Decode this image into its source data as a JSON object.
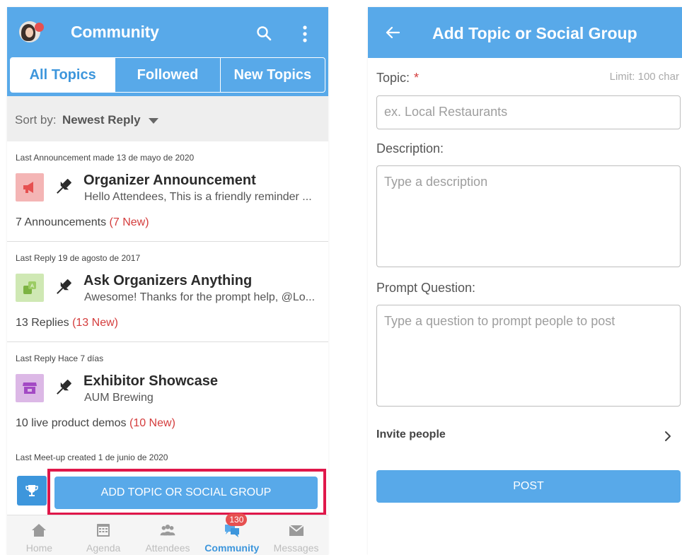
{
  "community": {
    "header": {
      "title": "Community"
    },
    "tabs": [
      {
        "label": "All Topics",
        "active": true
      },
      {
        "label": "Followed",
        "active": false
      },
      {
        "label": "New Topics",
        "active": false
      }
    ],
    "sort": {
      "label": "Sort by:",
      "value": "Newest Reply"
    },
    "topics": [
      {
        "meta": "Last Announcement made 13 de mayo de 2020",
        "icon": "megaphone-icon",
        "title": "Organizer Announcement",
        "subtitle": "Hello Attendees, This is a friendly reminder ...",
        "count": "7 Announcements",
        "new": "(7 New)"
      },
      {
        "meta": "Last Reply 19 de agosto de 2017",
        "icon": "translate-icon",
        "title": "Ask Organizers Anything",
        "subtitle": "Awesome! Thanks for the prompt help, @Lo...",
        "count": "13 Replies",
        "new": "(13 New)"
      },
      {
        "meta": "Last Reply Hace 7 días",
        "icon": "storefront-icon",
        "title": "Exhibitor Showcase",
        "subtitle": "AUM Brewing",
        "count": "10 live product demos",
        "new": "(10 New)"
      },
      {
        "meta": "Last Meet-up created 1 de junio de 2020",
        "icon": "trophy-icon"
      }
    ],
    "add_button": "ADD TOPIC OR SOCIAL GROUP",
    "nav": [
      {
        "label": "Home",
        "icon": "home-icon"
      },
      {
        "label": "Agenda",
        "icon": "calendar-icon"
      },
      {
        "label": "Attendees",
        "icon": "people-icon"
      },
      {
        "label": "Community",
        "icon": "chat-icon",
        "badge": "130",
        "active": true
      },
      {
        "label": "Messages",
        "icon": "mail-icon"
      }
    ],
    "colors": {
      "primary": "#58a9e9",
      "accent_text": "#3d96dc",
      "new_red": "#d43c3c",
      "highlight": "#e0174a",
      "badge": "#e65050"
    }
  },
  "add_form": {
    "header": {
      "title": "Add Topic or Social Group"
    },
    "topic": {
      "label": "Topic:",
      "required_mark": "*",
      "limit": "Limit: 100 char",
      "placeholder": "ex. Local Restaurants"
    },
    "description": {
      "label": "Description:",
      "placeholder": "Type a description"
    },
    "prompt": {
      "label": "Prompt Question:",
      "placeholder": "Type a question to prompt people to post"
    },
    "invite_label": "Invite people",
    "post_button": "POST"
  }
}
